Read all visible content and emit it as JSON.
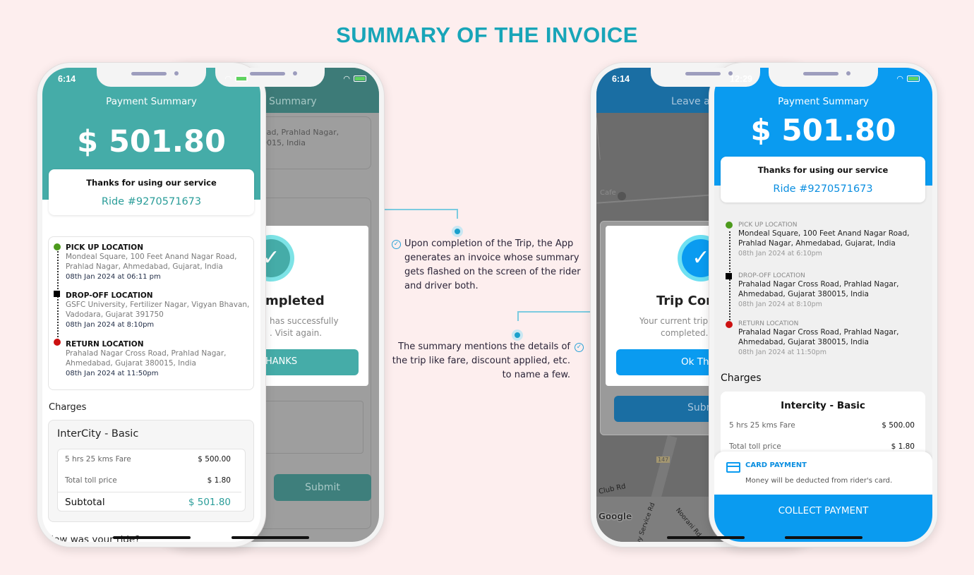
{
  "page_title": "SUMMARY OF THE INVOICE",
  "annotations": [
    {
      "icon": "check-circle-icon",
      "lines": [
        "Upon completion of the Trip, the App",
        "generates an invoice whose summary",
        "gets flashed on the screen of the rider",
        "and driver both."
      ]
    },
    {
      "icon": "check-circle-icon",
      "lines": [
        "The summary mentions the details of",
        "the trip like fare, discount applied, etc.",
        "to name a few."
      ]
    }
  ],
  "rider_back": {
    "header_fragment": "Summary",
    "addr_fragments": [
      "oad, Prahlad Nagar,",
      "0015, India",
      "n"
    ],
    "dialog_title_fragment": "mpleted",
    "dialog_text_fragments": [
      "has successfully",
      ". Visit again."
    ],
    "button_fragment": "HANKS",
    "submit": "Submit",
    "accent": "#45aca8"
  },
  "rider_front": {
    "status_time": "6:14",
    "header_title": "Payment Summary",
    "amount": "$ 501.80",
    "thanks": "Thanks for using our service",
    "ride_id": "Ride #9270571673",
    "accent": "#45aca8",
    "locations": [
      {
        "title": "PICK UP LOCATION",
        "addr": [
          "Mondeal Square, 100 Feet Anand Nagar Road,",
          "Prahlad Nagar, Ahmedabad, Gujarat, India"
        ],
        "time": "08th Jan 2024 at 06:11 pm",
        "marker": "green-dot"
      },
      {
        "title": "DROP-OFF LOCATION",
        "addr": [
          "GSFC University, Fertilizer Nagar, Vigyan Bhavan,",
          "Vadodara, Gujarat 391750"
        ],
        "time": "08th Jan 2024 at 8:10pm",
        "marker": "black-square"
      },
      {
        "title": "RETURN LOCATION",
        "addr": [
          "Prahalad Nagar Cross Road, Prahlad Nagar,",
          "Ahmedabad, Gujarat 380015, India"
        ],
        "time": "08th Jan 2024 at 11:50pm",
        "marker": "red-dot"
      }
    ],
    "charges_label": "Charges",
    "plan": "InterCity - Basic",
    "rows": [
      {
        "label": "5 hrs 25 kms Fare",
        "value": "$ 500.00"
      },
      {
        "label": "Total toll price",
        "value": "$ 1.80"
      }
    ],
    "subtotal_label": "Subtotal",
    "subtotal_value": "$ 501.80",
    "rating_prompt": "How was your ride?"
  },
  "driver_back": {
    "status_time": "6:14",
    "header_fragment": "Leave a",
    "map_labels": [
      "Cafe",
      "147",
      "Club Rd",
      "Noorani Rd",
      "wy Service Rd",
      "Google"
    ],
    "dialog_title_fragment": "Trip Com",
    "dialog_text_fragments": [
      "Your current trip",
      "completed. V"
    ],
    "button_fragment": "Ok Th",
    "submit_fragment": "Subm",
    "accent": "#1a6ea3"
  },
  "driver_front": {
    "status_time": "12:29",
    "header_title": "Payment Summary",
    "amount": "$ 501.80",
    "thanks": "Thanks for using our service",
    "ride_id": "Ride #9270571673",
    "accent": "#0a9bf0",
    "locations": [
      {
        "title": "PICK UP LOCATION",
        "addr": [
          "Mondeal Square, 100 Feet Anand Nagar Road,",
          "Prahlad Nagar, Ahmedabad, Gujarat, India"
        ],
        "time": "08th Jan 2024 at 6:10pm"
      },
      {
        "title": "DROP-OFF LOCATION",
        "addr": [
          "Prahalad Nagar Cross Road, Prahlad Nagar,",
          "Ahmedabad, Gujarat 380015, India"
        ],
        "time": "08th Jan 2024 at 8:10pm"
      },
      {
        "title": "RETURN LOCATION",
        "addr": [
          "Prahalad Nagar Cross Road, Prahlad Nagar,",
          "Ahmedabad, Gujarat 380015, India"
        ],
        "time": "08th Jan 2024 at 11:50pm"
      }
    ],
    "charges_label": "Charges",
    "plan": "Intercity - Basic",
    "rows": [
      {
        "label": "5 hrs 25 kms Fare",
        "value": "$ 500.00"
      },
      {
        "label": "Total toll price",
        "value": "$ 1.80"
      }
    ],
    "payment_method": "CARD PAYMENT",
    "payment_note": "Money will be deducted from rider's card.",
    "collect_button": "COLLECT PAYMENT"
  }
}
